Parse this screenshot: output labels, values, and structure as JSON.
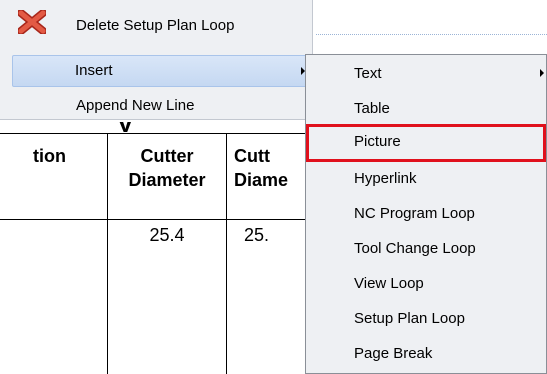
{
  "context_menu": {
    "items": [
      {
        "label": "Delete Setup Plan Loop",
        "icon": "delete-x-icon"
      },
      {
        "label": "Insert",
        "has_submenu": true,
        "selected": true
      },
      {
        "label": "Append New Line"
      }
    ]
  },
  "insert_submenu": {
    "items": [
      {
        "label": "Text",
        "has_submenu": true
      },
      {
        "label": "Table"
      },
      {
        "label": "Picture",
        "highlighted": true
      },
      {
        "label": "Hyperlink"
      },
      {
        "label": "NC Program Loop"
      },
      {
        "label": "Tool Change Loop"
      },
      {
        "label": "View Loop"
      },
      {
        "label": "Setup Plan Loop"
      },
      {
        "label": "Page Break"
      }
    ]
  },
  "document_table": {
    "headers": [
      "tion",
      "Cutter Diameter",
      "Cutt Diame"
    ],
    "header_lines": [
      [
        "tion"
      ],
      [
        "Cutter",
        "Diameter"
      ],
      [
        "Cutt",
        "Diame"
      ]
    ],
    "rows": [
      [
        "",
        "25.4",
        "25."
      ]
    ]
  },
  "colors": {
    "menu_bg": "#eef0f3",
    "selection": "#c5d8f2",
    "highlight_border": "#e0101c",
    "delete_icon": "#d9442f"
  }
}
